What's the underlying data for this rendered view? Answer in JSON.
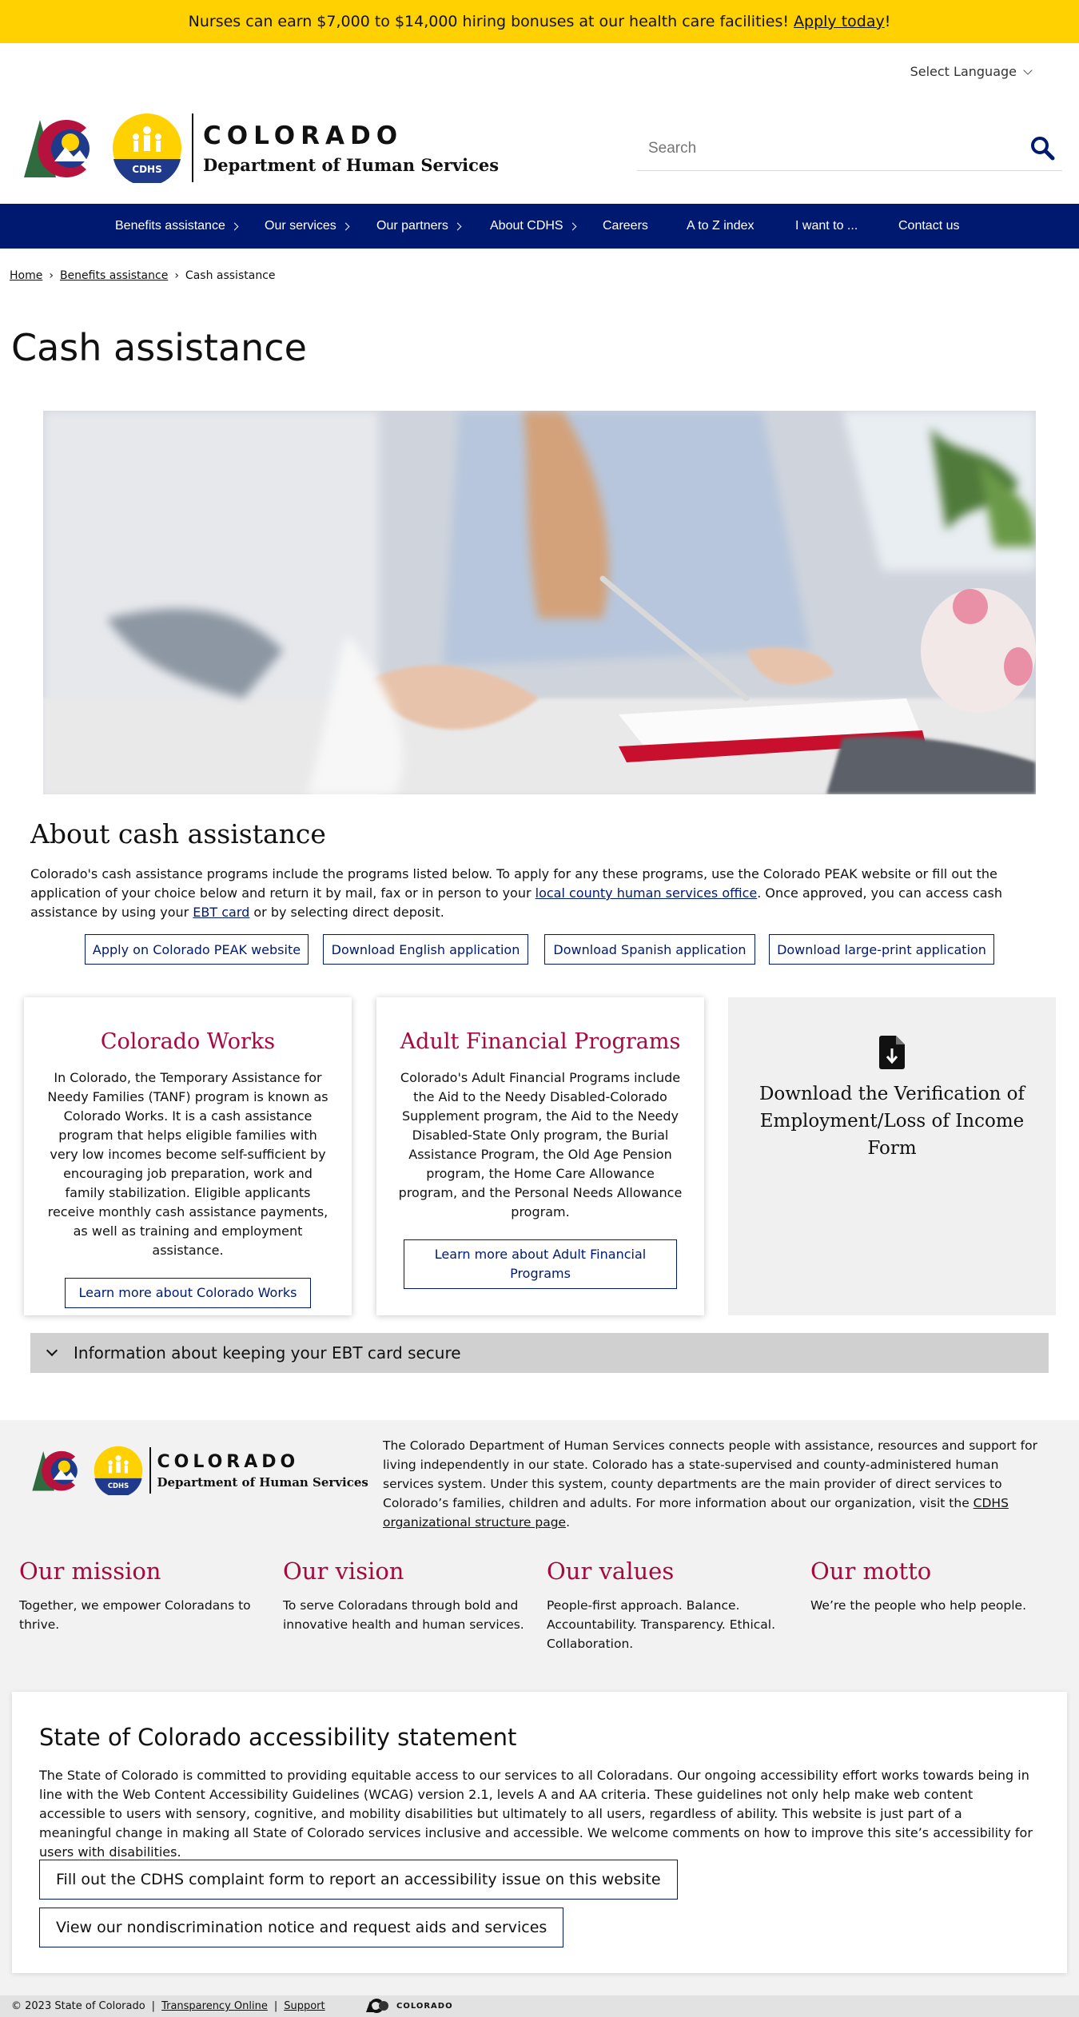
{
  "banner": {
    "text": "Nurses can earn $7,000 to $14,000 hiring bonuses at our health care facilities!",
    "link": "Apply today",
    "suffix": "!"
  },
  "language": {
    "label": "Select Language"
  },
  "header": {
    "state": "COLORADO",
    "department": "Department of Human Services",
    "badge_text": "CDHS"
  },
  "search": {
    "placeholder": "Search"
  },
  "nav": {
    "items": [
      {
        "label": "Benefits assistance",
        "has_arrow": true
      },
      {
        "label": "Our services",
        "has_arrow": true
      },
      {
        "label": "Our partners",
        "has_arrow": true
      },
      {
        "label": "About CDHS",
        "has_arrow": true
      },
      {
        "label": "Careers",
        "has_arrow": false
      },
      {
        "label": "A to Z index",
        "has_arrow": false
      },
      {
        "label": "I want to ...",
        "has_arrow": false
      },
      {
        "label": "Contact us",
        "has_arrow": false
      }
    ]
  },
  "breadcrumb": {
    "home": "Home",
    "parent": "Benefits assistance",
    "current": "Cash assistance",
    "sep": "›"
  },
  "page": {
    "title": "Cash assistance"
  },
  "about": {
    "heading": "About cash assistance",
    "text_1": "Colorado's cash assistance programs include the programs listed below. To apply for any these programs, use the Colorado PEAK website or fill out the application of your choice below and return it by mail, fax or in person to your ",
    "link_1": "local county human services office",
    "text_2": ". Once approved, you can access cash assistance by using your ",
    "link_2": "EBT card",
    "text_3": " or by selecting direct deposit.",
    "buttons": [
      "Apply on Colorado PEAK website",
      "Download English application",
      "Download Spanish application",
      "Download large-print application"
    ]
  },
  "cards": {
    "works": {
      "title": "Colorado Works",
      "text": "In Colorado, the Temporary Assistance for Needy Families (TANF) program is known as Colorado Works. It is a cash assistance program that helps eligible families with very low incomes become self-sufficient by encouraging job preparation, work and family stabilization. Eligible applicants receive monthly cash assistance payments, as well as training and employment assistance.",
      "button": "Learn more about Colorado Works"
    },
    "adult": {
      "title": "Adult Financial Programs",
      "text": "Colorado's Adult Financial Programs include the Aid to the Needy Disabled-Colorado Supplement program, the Aid to the Needy Disabled-State Only program, the Burial Assistance Program, the Old Age Pension program, the Home Care Allowance program, and the Personal Needs Allowance program.",
      "button": "Learn more about Adult Financial Programs"
    },
    "download": {
      "title": "Download the Verification of Employment/Loss of Income Form",
      "icon": "file-download-icon"
    }
  },
  "accordion": {
    "label": "Information about keeping your EBT card secure"
  },
  "footer": {
    "state": "COLORADO",
    "department": "Department of Human Services",
    "badge_text": "CDHS",
    "about_text": "The Colorado Department of Human Services connects people with assistance, resources and support for living independently in our state. Colorado has a state-supervised and county-administered human services system. Under this system, county departments are the main provider of direct services to Colorado’s families, children and adults. For more information about our organization, visit the ",
    "about_link": "CDHS organizational structure page",
    "about_end": ".",
    "pillars": [
      {
        "title": "Our mission",
        "text": "Together, we empower Coloradans to thrive."
      },
      {
        "title": "Our vision",
        "text": "To serve Coloradans through bold and innovative health and human services."
      },
      {
        "title": "Our values",
        "text": "People-first approach. Balance. Accountability. Transparency. Ethical. Collaboration."
      },
      {
        "title": "Our motto",
        "text": "We’re the people who help people."
      }
    ],
    "accessibility": {
      "heading": "State of Colorado accessibility statement",
      "text": "The State of Colorado is committed to providing equitable access to our services to all Coloradans. Our ongoing accessibility effort works towards being in line with the Web Content Accessibility Guidelines (WCAG) version 2.1, levels A and AA criteria. These guidelines not only help make web content accessible to users with sensory, cognitive, and mobility disabilities but ultimately to all users, regardless of ability. This website is just part of a meaningful change in making all State of Colorado services inclusive and accessible. We welcome comments on how to improve this site’s accessibility for users with disabilities.",
      "button_1": "Fill out the CDHS complaint form to report an accessibility issue on this website",
      "button_2": "View our nondiscrimination notice and request aids and services"
    },
    "bottom": {
      "copyright": "© 2023 State of Colorado",
      "sep": "|",
      "link_1": "Transparency Online",
      "link_2": "Support",
      "portal_name": "COLORADO"
    }
  },
  "colors": {
    "banner": "#ffd100",
    "nav": "#001970",
    "accent_red": "#a6093d",
    "footer_bg": "#f2f2f2"
  }
}
